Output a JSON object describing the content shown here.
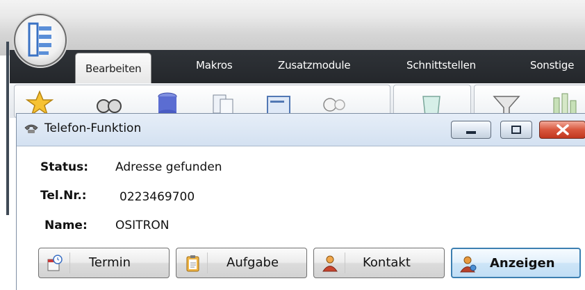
{
  "app": {
    "tabs": [
      "Bearbeiten",
      "Makros",
      "Zusatzmodule",
      "Schnittstellen",
      "Sonstige"
    ],
    "active_tab": "Bearbeiten"
  },
  "dialog": {
    "title": "Telefon-Funktion",
    "fields": [
      {
        "label": "Status:",
        "value": "Adresse gefunden"
      },
      {
        "label": "Tel.Nr.:",
        "value": "0223469700"
      },
      {
        "label": "Name:",
        "value": "OSITRON"
      }
    ],
    "buttons": {
      "termin": "Termin",
      "aufgabe": "Aufgabe",
      "kontakt": "Kontakt",
      "anzeigen": "Anzeigen"
    }
  },
  "colors": {
    "accent": "#3c7fb1",
    "close": "#c2371f",
    "tabstrip": "#2a2d31"
  }
}
